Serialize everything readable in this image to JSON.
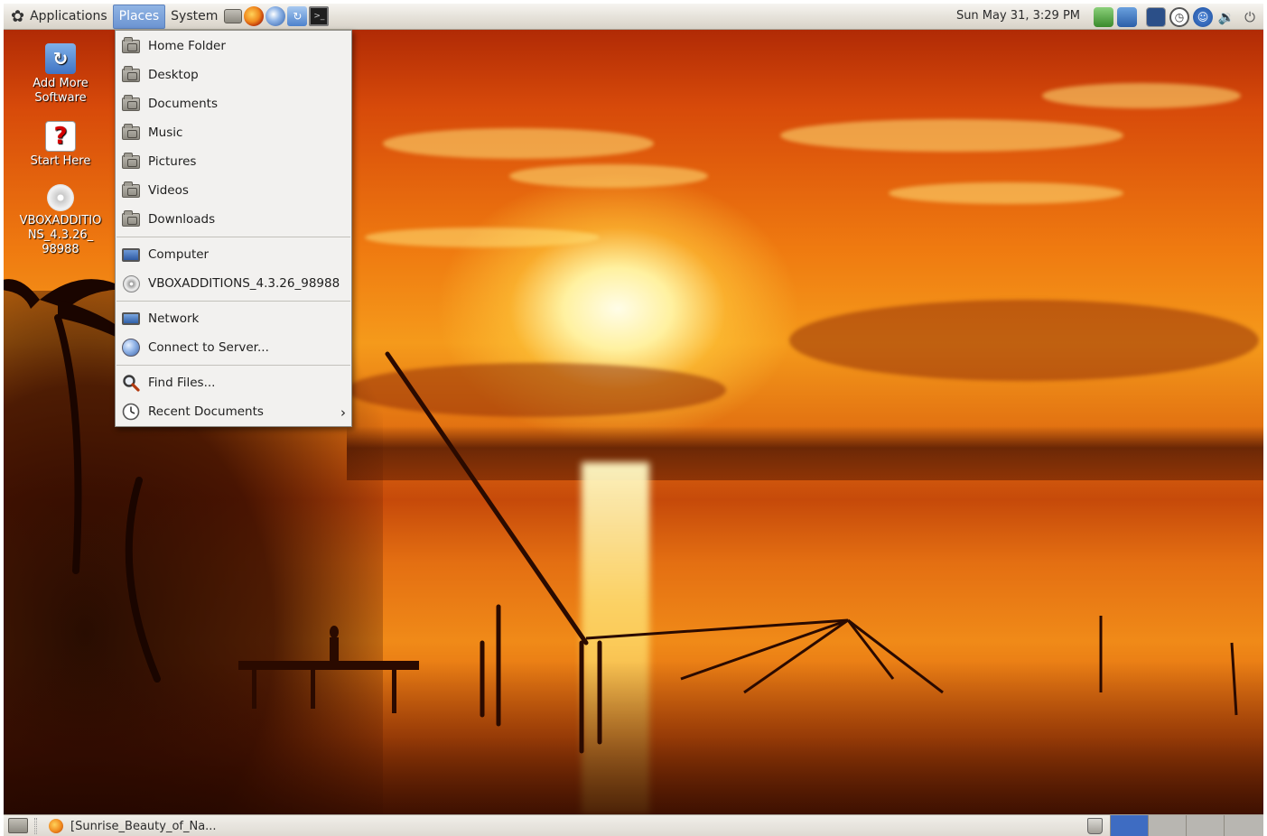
{
  "top_panel": {
    "menus": {
      "applications": "Applications",
      "places": "Places",
      "system": "System"
    },
    "launchers": [
      "home-folder-icon",
      "firefox-icon",
      "thunderbird-icon",
      "update-manager-icon",
      "terminal-icon"
    ],
    "clock": "Sun May 31,  3:29 PM",
    "tray_icons": [
      "network-manager-icon",
      "vm-network-icon",
      "system-monitor-icon",
      "clock-icon",
      "accessibility-icon",
      "volume-icon",
      "power-icon"
    ]
  },
  "desktop": {
    "icons": [
      {
        "label": "Add More Software",
        "icon": "software-center-icon"
      },
      {
        "label": "Start Here",
        "icon": "help-icon"
      },
      {
        "label": "VBOXADDITIONS_4.3.26_98988",
        "icon": "cd-disc-icon"
      }
    ],
    "desktop_icon_labels": {
      "add_software_line1": "Add More",
      "add_software_line2": "Software",
      "start_here": "Start Here",
      "vbox_line1": "VBOXADDITIO",
      "vbox_line2": "NS_4.3.26_",
      "vbox_line3": "98988"
    }
  },
  "places_menu": {
    "home_folder": "Home Folder",
    "desktop": "Desktop",
    "documents": "Documents",
    "music": "Music",
    "pictures": "Pictures",
    "videos": "Videos",
    "downloads": "Downloads",
    "computer": "Computer",
    "vboxadditions": "VBOXADDITIONS_4.3.26_98988",
    "network": "Network",
    "connect_to_server": "Connect to Server...",
    "find_files": "Find Files...",
    "recent_documents": "Recent Documents"
  },
  "bottom_panel": {
    "task_label": "[Sunrise_Beauty_of_Na...",
    "workspace_count": 4,
    "active_workspace": 1
  },
  "colors": {
    "panel_bg": "#e5e1d9",
    "menu_highlight": "#7aa0d8",
    "menu_bg": "#f2f1ef",
    "active_workspace": "#3e6cc2",
    "inactive_workspace": "#b8b6b1"
  }
}
